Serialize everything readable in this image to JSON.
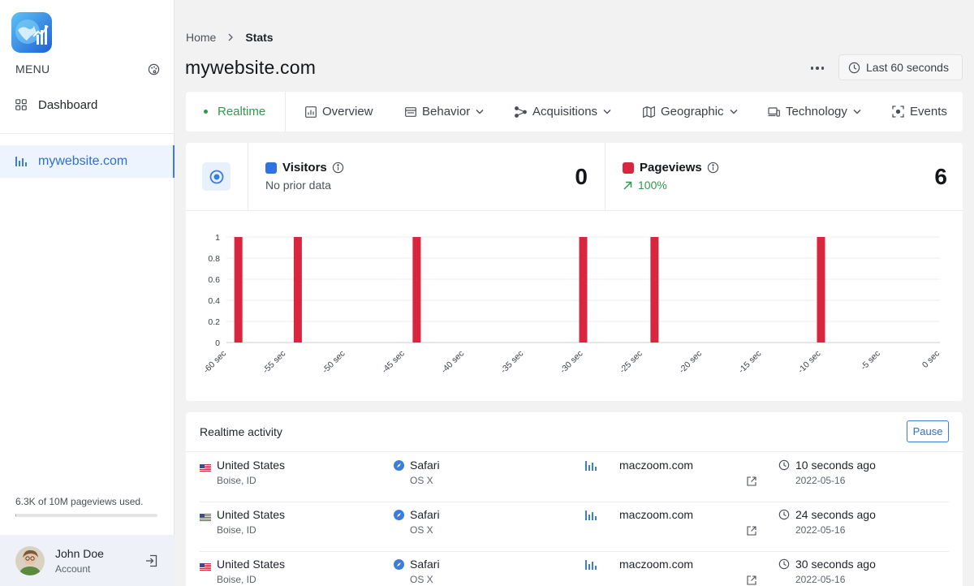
{
  "sidebar": {
    "menu_label": "MENU",
    "nav": [
      {
        "label": "Dashboard",
        "icon": "grid-icon"
      },
      {
        "label": "mywebsite.com",
        "icon": "bar-chart-icon",
        "active": true
      }
    ],
    "usage_text": "6.3K of 10M pageviews used.",
    "usage_fraction": 0.00063,
    "account": {
      "name": "John Doe",
      "subtitle": "Account"
    }
  },
  "breadcrumb": {
    "home": "Home",
    "current": "Stats"
  },
  "page_title": "mywebsite.com",
  "time_range": "Last 60 seconds",
  "tabs": [
    {
      "label": "Realtime",
      "active": true
    },
    {
      "label": "Overview"
    },
    {
      "label": "Behavior",
      "dropdown": true
    },
    {
      "label": "Acquisitions",
      "dropdown": true
    },
    {
      "label": "Geographic",
      "dropdown": true
    },
    {
      "label": "Technology",
      "dropdown": true
    },
    {
      "label": "Events"
    }
  ],
  "metrics": {
    "visitors": {
      "label": "Visitors",
      "sub": "No prior data",
      "value": "0",
      "color": "#2f72e0"
    },
    "pageviews": {
      "label": "Pageviews",
      "sub": "100%",
      "value": "6",
      "color": "#d7263d"
    }
  },
  "chart_data": {
    "type": "bar",
    "x_ticks": [
      "-60 sec",
      "-55 sec",
      "-50 sec",
      "-45 sec",
      "-40 sec",
      "-35 sec",
      "-30 sec",
      "-25 sec",
      "-20 sec",
      "-15 sec",
      "-10 sec",
      "-5 sec",
      "0 sec"
    ],
    "y_ticks": [
      "0",
      "0.2",
      "0.4",
      "0.6",
      "0.8",
      "1"
    ],
    "ylim": [
      0,
      1
    ],
    "xlim": [
      -60,
      0
    ],
    "series": [
      {
        "name": "Pageviews",
        "color": "#d7263d",
        "x": [
          -59,
          -54,
          -44,
          -30,
          -24,
          -10
        ],
        "values": [
          1,
          1,
          1,
          1,
          1,
          1
        ]
      }
    ]
  },
  "activity": {
    "title": "Realtime activity",
    "pause_label": "Pause",
    "rows": [
      {
        "country": "United States",
        "city": "Boise, ID",
        "browser": "Safari",
        "os": "OS X",
        "site": "maczoom.com",
        "time": "10 seconds ago",
        "date": "2022-05-16"
      },
      {
        "country": "United States",
        "city": "Boise, ID",
        "browser": "Safari",
        "os": "OS X",
        "site": "maczoom.com",
        "time": "24 seconds ago",
        "date": "2022-05-16"
      },
      {
        "country": "United States",
        "city": "Boise, ID",
        "browser": "Safari",
        "os": "OS X",
        "site": "maczoom.com",
        "time": "30 seconds ago",
        "date": "2022-05-16"
      }
    ]
  }
}
